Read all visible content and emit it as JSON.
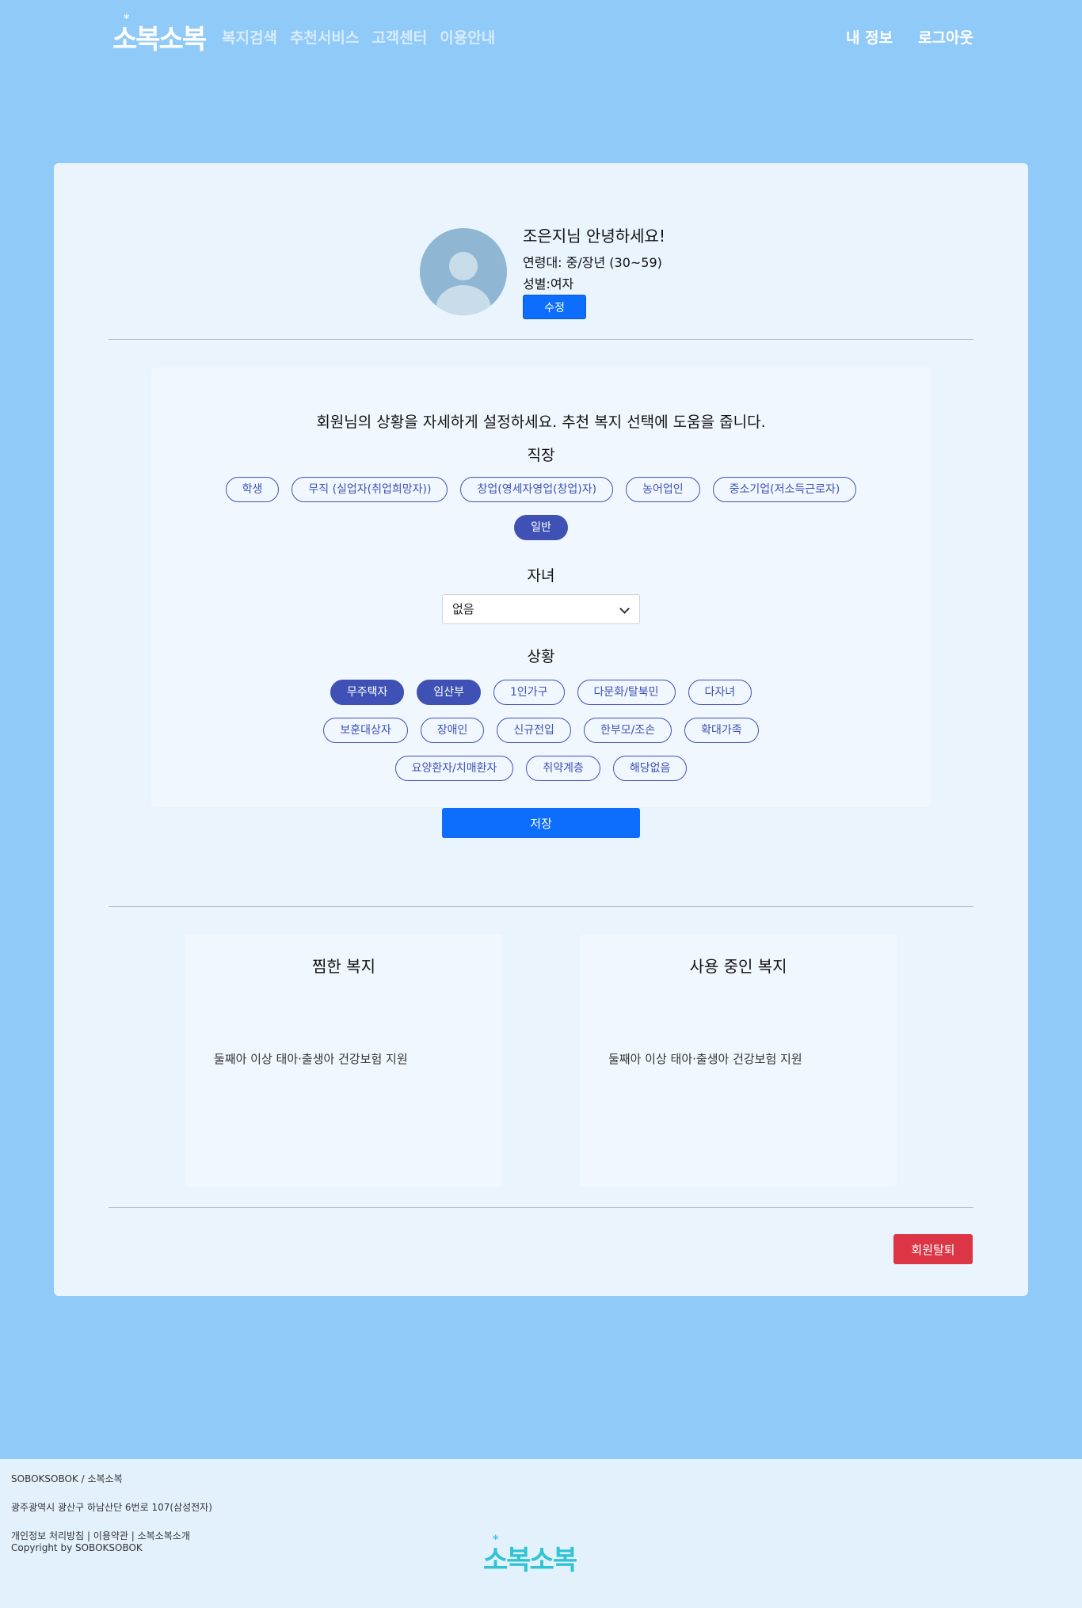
{
  "brand": {
    "logo_text": "소복소복",
    "logo_star": "*"
  },
  "nav": {
    "menu": [
      "복지검색",
      "추천서비스",
      "고객센터",
      "이용안내"
    ],
    "my_info": "내 정보",
    "logout": "로그아웃"
  },
  "profile": {
    "greeting": "조은지님 안녕하세요!",
    "age": "연령대: 중/장년 (30~59)",
    "gender": "성별:여자",
    "edit_label": "수정"
  },
  "settings": {
    "title": "회원님의 상황을 자세하게 설정하세요. 추천 복지 선택에 도움을 줍니다.",
    "job": {
      "title": "직장",
      "row1": [
        {
          "label": "학생",
          "selected": false
        },
        {
          "label": "무직 (실업자(취업희망자))",
          "selected": false
        },
        {
          "label": "창업(영세자영업(창업)자)",
          "selected": false
        },
        {
          "label": "농어업인",
          "selected": false
        },
        {
          "label": "중소기업(저소득근로자)",
          "selected": false
        }
      ],
      "row2": [
        {
          "label": "일반",
          "selected": true
        }
      ]
    },
    "children": {
      "title": "자녀",
      "selected": "없음"
    },
    "situation": {
      "title": "상황",
      "row1": [
        {
          "label": "무주택자",
          "selected": true
        },
        {
          "label": "임산부",
          "selected": true
        },
        {
          "label": "1인가구",
          "selected": false
        },
        {
          "label": "다문화/탈북민",
          "selected": false
        },
        {
          "label": "다자녀",
          "selected": false
        }
      ],
      "row2": [
        {
          "label": "보훈대상자",
          "selected": false
        },
        {
          "label": "장애인",
          "selected": false
        },
        {
          "label": "신규전입",
          "selected": false
        },
        {
          "label": "한부모/조손",
          "selected": false
        },
        {
          "label": "확대가족",
          "selected": false
        }
      ],
      "row3": [
        {
          "label": "요양환자/치매환자",
          "selected": false
        },
        {
          "label": "취약계층",
          "selected": false
        },
        {
          "label": "해당없음",
          "selected": false
        }
      ]
    },
    "save_label": "저장"
  },
  "saved": {
    "title": "찜한 복지",
    "items": [
      "둘째아 이상 태아·출생아 건강보험 지원"
    ]
  },
  "in_use": {
    "title": "사용 중인 복지",
    "items": [
      "둘째아 이상 태아·출생아 건강보험 지원"
    ]
  },
  "withdraw_label": "회원탈퇴",
  "footer": {
    "company": "SOBOKSOBOK / 소복소복",
    "address": "광주광역시 광산구 하남산단 6번로 107(삼성전자)",
    "links": "개인정보 처리방침 | 이용약관 | 소복소복소개",
    "copyright": "Copyright by SOBOKSOBOK",
    "logo_text": "소복소복"
  },
  "colors": {
    "background": "#90caf9",
    "card": "#eaf4fd",
    "primary": "#0d6efd",
    "chip": "#3f51b5",
    "danger": "#dc3545",
    "footer_logo": "#2ec4d3"
  }
}
